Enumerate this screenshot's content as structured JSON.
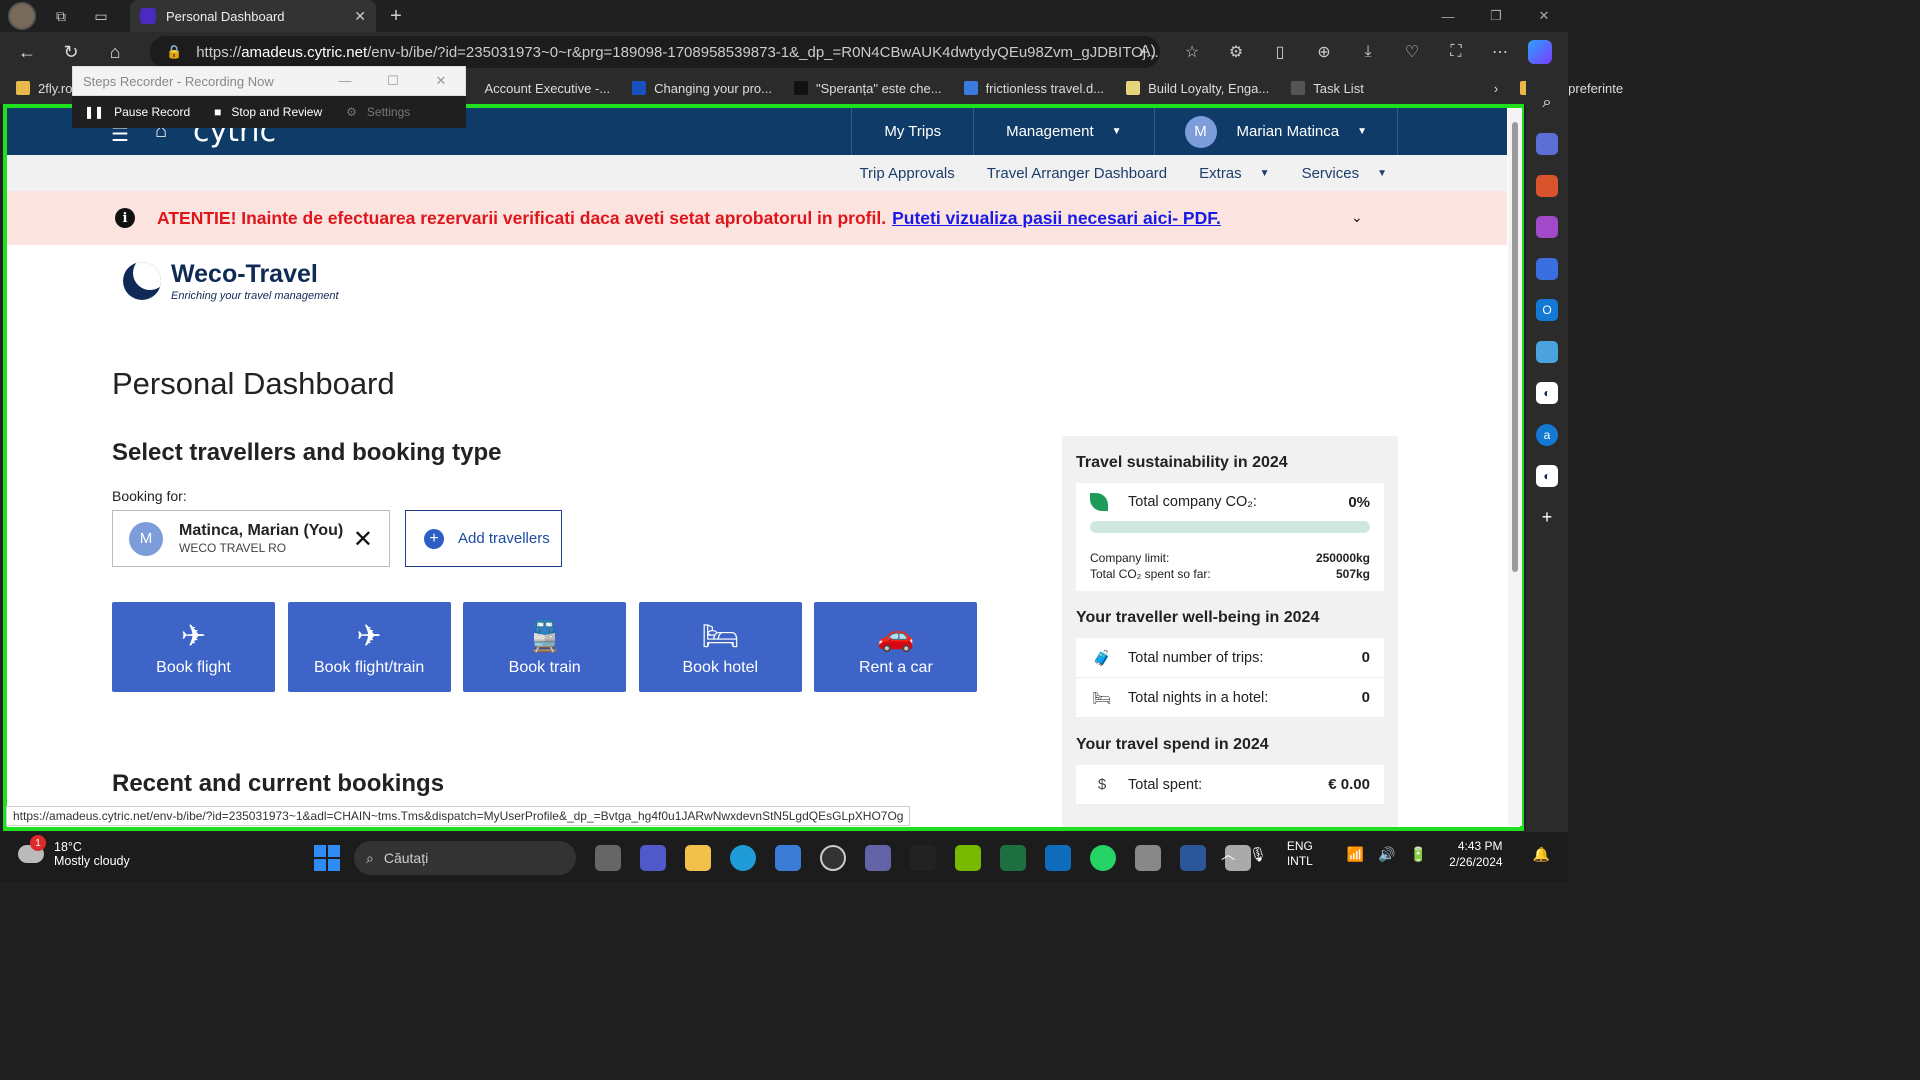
{
  "browser": {
    "tab_title": "Personal Dashboard",
    "url_prefix": "https://",
    "url_host": "amadeus.cytric.net",
    "url_path": "/env-b/ibe/?id=235031973~0~r&prg=189098-1708958539873-1&_dp_=R0N4CBwAUK4dwtydyQEu98Zvm_gJDBITOj...",
    "bookmarks": [
      {
        "label": "2fly.ro"
      },
      {
        "label": "Account Executive -..."
      },
      {
        "label": "Changing your pro..."
      },
      {
        "label": "\"Speranța\" este che..."
      },
      {
        "label": "frictionless travel.d..."
      },
      {
        "label": "Build Loyalty, Enga..."
      },
      {
        "label": "Task List"
      },
      {
        "label": "Alte preferinte"
      }
    ],
    "status_url": "https://amadeus.cytric.net/env-b/ibe/?id=235031973~1&adl=CHAIN~tms.Tms&dispatch=MyUserProfile&_dp_=Bvtga_hg4f0u1JARwNwxdevnStN5LgdQEsGLpXHO7Og"
  },
  "recorder": {
    "title": "Steps Recorder - Recording Now",
    "pause": "Pause Record",
    "stop": "Stop and Review",
    "settings": "Settings"
  },
  "topnav": {
    "logo": "cytric",
    "my_trips": "My Trips",
    "management": "Management",
    "user_initial": "M",
    "user_name": "Marian Matinca"
  },
  "subnav": {
    "trip_approvals": "Trip Approvals",
    "arranger": "Travel Arranger Dashboard",
    "extras": "Extras",
    "services": "Services"
  },
  "alert": {
    "text": "ATENTIE! Inainte de efectuarea rezervarii verificati daca aveti setat aprobatorul in profil.",
    "link": "Puteti vizualiza pasii necesari aici- PDF."
  },
  "brand": {
    "name": "Weco-Travel",
    "tagline": "Enriching your travel management"
  },
  "main": {
    "title": "Personal Dashboard",
    "section_title": "Select travellers and booking type",
    "booking_for": "Booking for:",
    "traveller_initial": "M",
    "traveller_name": "Matinca, Marian (You)",
    "traveller_company": "WECO TRAVEL RO",
    "add_travellers": "Add travellers",
    "booking_buttons": [
      {
        "label": "Book flight",
        "icon": "plane-icon"
      },
      {
        "label": "Book flight/train",
        "icon": "plane-train-icon"
      },
      {
        "label": "Book train",
        "icon": "train-icon"
      },
      {
        "label": "Book hotel",
        "icon": "bed-icon"
      },
      {
        "label": "Rent a car",
        "icon": "car-icon"
      }
    ],
    "recent_title": "Recent and current bookings"
  },
  "sidebar": {
    "sustainability_title": "Travel sustainability in 2024",
    "co2_label": "Total company CO₂:",
    "co2_value": "0%",
    "co2_progress": 0,
    "company_limit_label": "Company limit:",
    "company_limit_value": "250000kg",
    "co2_spent_label": "Total CO₂ spent so far:",
    "co2_spent_value": "507kg",
    "wellbeing_title": "Your traveller well-being in 2024",
    "trips_label": "Total number of trips:",
    "trips_value": "0",
    "nights_label": "Total nights in a hotel:",
    "nights_value": "0",
    "spend_title": "Your travel spend in 2024",
    "spent_label": "Total spent:",
    "spent_value": "€ 0.00"
  },
  "taskbar": {
    "temp": "18°C",
    "weather": "Mostly cloudy",
    "weather_badge": "1",
    "search": "Căutați",
    "lang_top": "ENG",
    "lang_bottom": "INTL",
    "time": "4:43 PM",
    "date": "2/26/2024"
  },
  "colors": {
    "accent_nav": "#0f3b68",
    "booking_button": "#3d64c6",
    "alert_red": "#e0151b",
    "frame_green": "#1fe01f"
  }
}
